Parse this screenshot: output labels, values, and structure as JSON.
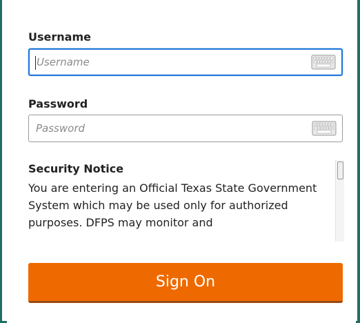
{
  "login_form": {
    "username": {
      "label": "Username",
      "placeholder": "Username",
      "value": ""
    },
    "password": {
      "label": "Password",
      "placeholder": "Password",
      "value": ""
    },
    "keyboard_icon": "keyboard-icon",
    "security_notice": {
      "heading": "Security Notice",
      "text": "You are entering an Official Texas State Government System which may be used only for authorized purposes. DFPS may monitor and"
    },
    "sign_on_label": "Sign On"
  },
  "colors": {
    "accent": "#ee6a00",
    "focus": "#1a73d9",
    "frame": "#1f6f63"
  }
}
